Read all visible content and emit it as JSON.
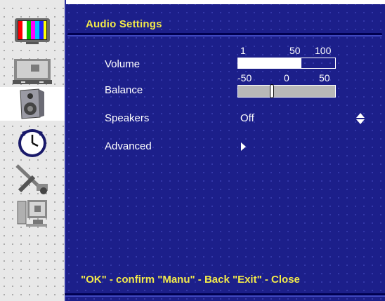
{
  "title": "Audio Settings",
  "sidebar": {
    "items": [
      {
        "icon": "tv-color-bars-icon",
        "active": false
      },
      {
        "icon": "monitor-image-icon",
        "active": false
      },
      {
        "icon": "speaker-icon",
        "active": true
      },
      {
        "icon": "clock-icon",
        "active": false
      },
      {
        "icon": "tools-icon",
        "active": false
      },
      {
        "icon": "computer-icon",
        "active": false
      }
    ]
  },
  "menu": {
    "volume": {
      "label": "Volume",
      "scale": [
        "1",
        "50",
        "100"
      ],
      "level_percent": 65
    },
    "balance": {
      "label": "Balance",
      "scale": [
        "-50",
        "0",
        "50"
      ],
      "value": -16
    },
    "speakers": {
      "label": "Speakers",
      "value": "Off"
    },
    "advanced": {
      "label": "Advanced"
    }
  },
  "footer": "\"OK\" - confirm \"Manu\" - Back \"Exit\" - Close",
  "colors": {
    "panel": "#1c1f8a",
    "title": "#f2e94a",
    "text": "#ffffff"
  }
}
